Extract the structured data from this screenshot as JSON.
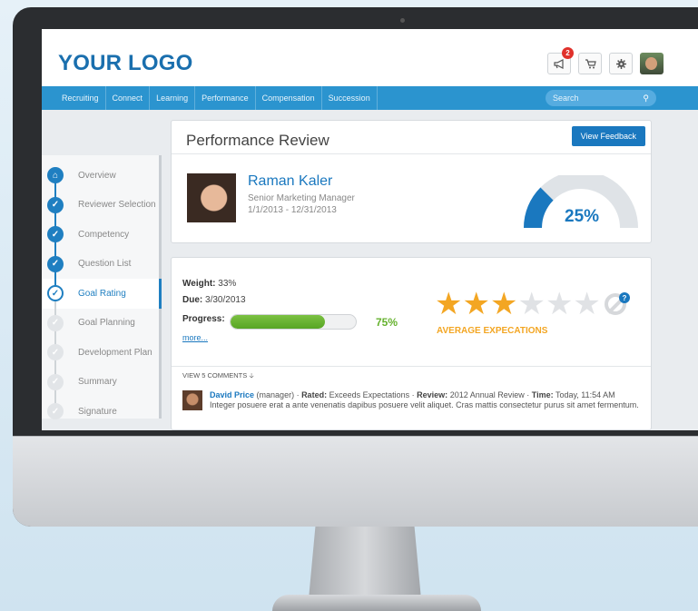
{
  "header": {
    "logo": "YOUR LOGO",
    "notifications_badge": "2",
    "icons": [
      "megaphone-icon",
      "cart-icon",
      "gear-icon",
      "avatar"
    ]
  },
  "nav": {
    "items": [
      "Recruiting",
      "Connect",
      "Learning",
      "Performance",
      "Compensation",
      "Succession"
    ],
    "search_placeholder": "Search"
  },
  "sidebar": {
    "steps": [
      {
        "label": "Overview",
        "state": "home"
      },
      {
        "label": "Reviewer Selection",
        "state": "done"
      },
      {
        "label": "Competency",
        "state": "done"
      },
      {
        "label": "Question List",
        "state": "done"
      },
      {
        "label": "Goal Rating",
        "state": "active"
      },
      {
        "label": "Goal Planning",
        "state": "todo"
      },
      {
        "label": "Development Plan",
        "state": "todo"
      },
      {
        "label": "Summary",
        "state": "todo"
      },
      {
        "label": "Signature",
        "state": "todo"
      }
    ]
  },
  "review": {
    "title": "Performance Review",
    "view_feedback": "View Feedback",
    "name": "Raman Kaler",
    "role": "Senior Marketing Manager",
    "period": "1/1/2013 - 12/31/2013",
    "completion_label": "25%",
    "completion_fraction": 0.25
  },
  "goal": {
    "weight_label": "Weight:",
    "weight_value": "33%",
    "due_label": "Due:",
    "due_value": "3/30/2013",
    "progress_label": "Progress:",
    "progress_text": "75%",
    "progress_fraction": 0.75,
    "more": "more...",
    "stars_filled": 3,
    "stars_total": 6,
    "rating_label": "AVERAGE EXPECATIONS",
    "help": "?"
  },
  "comments": {
    "toggle": "VIEW 5 COMMENTS",
    "author": "David Price",
    "role": "(manager)",
    "rated_label": "Rated:",
    "rated_value": "Exceeds Expectations",
    "review_label": "Review:",
    "review_value": "2012 Annual Review",
    "time_label": "Time:",
    "time_value": "Today, 11:54 AM",
    "body": "Integer posuere erat a ante venenatis dapibus posuere velit aliquet. Cras mattis consectetur purus sit amet fermentum."
  },
  "colors": {
    "primary": "#1a78bf",
    "nav": "#2b94cf",
    "progress": "#66b22f",
    "stars": "#f3a623"
  }
}
